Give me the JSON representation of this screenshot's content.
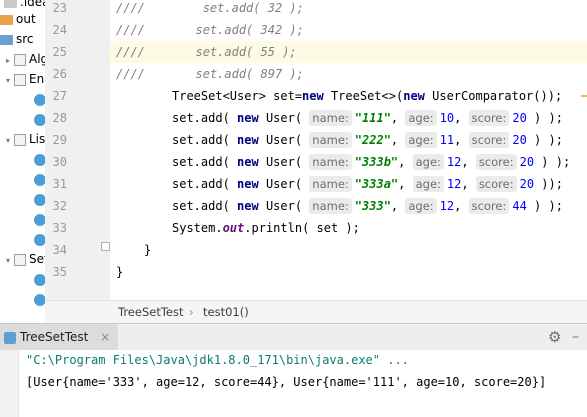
{
  "project_tree": {
    "items": [
      {
        "label": ".idea",
        "icon": "folder-plain"
      },
      {
        "label": "out",
        "icon": "folder-orange"
      },
      {
        "label": "src",
        "icon": "folder-blue"
      },
      {
        "label": "Alg",
        "icon": "package-icon"
      },
      {
        "label": "En",
        "icon": "package-icon"
      },
      {
        "label": "Lis",
        "icon": "package-icon"
      },
      {
        "label": "Set",
        "icon": "package-icon"
      }
    ]
  },
  "editor": {
    "lines": [
      {
        "num": "23"
      },
      {
        "num": "24"
      },
      {
        "num": "25"
      },
      {
        "num": "26"
      },
      {
        "num": "27"
      },
      {
        "num": "28"
      },
      {
        "num": "29"
      },
      {
        "num": "30"
      },
      {
        "num": "31"
      },
      {
        "num": "32"
      },
      {
        "num": "33"
      },
      {
        "num": "34"
      },
      {
        "num": "35"
      }
    ],
    "comment_prefix": "////",
    "commented_adds": [
      {
        "indent": "        ",
        "call": "set.add( ",
        "value": "32",
        "close": " );"
      },
      {
        "indent": "       ",
        "call": "set.add( ",
        "value": "342",
        "close": " );"
      },
      {
        "indent": "       ",
        "call": "set.add( ",
        "value": "55",
        "close": " );"
      },
      {
        "indent": "       ",
        "call": "set.add( ",
        "value": "897",
        "close": " );"
      }
    ],
    "treeset_line": {
      "type_text": "TreeSet<User> set=",
      "kw_new": "new",
      "mid_text": " TreeSet<>(",
      "kw_new2": "new",
      "end_text": " UserComparator());"
    },
    "add_calls": [
      {
        "prefix": "set.add( ",
        "kw": "new",
        "ctor": " User( ",
        "name_hint": "name:",
        "name": "\"111\"",
        "age_hint": "age:",
        "age": "10",
        "score_hint": "score:",
        "score": "20",
        "close": " ) );"
      },
      {
        "prefix": "set.add( ",
        "kw": "new",
        "ctor": " User( ",
        "name_hint": "name:",
        "name": "\"222\"",
        "age_hint": "age:",
        "age": "11",
        "score_hint": "score:",
        "score": "20",
        "close": " ) );"
      },
      {
        "prefix": "set.add( ",
        "kw": "new",
        "ctor": " User( ",
        "name_hint": "name:",
        "name": "\"333b\"",
        "age_hint": "age:",
        "age": "12",
        "score_hint": "score:",
        "score": "20",
        "close": " ) );"
      },
      {
        "prefix": "set.add( ",
        "kw": "new",
        "ctor": " User( ",
        "name_hint": "name:",
        "name": "\"333a\"",
        "age_hint": "age:",
        "age": "12",
        "score_hint": "score:",
        "score": "20",
        "close": " ));"
      },
      {
        "prefix": "set.add( ",
        "kw": "new",
        "ctor": " User( ",
        "name_hint": "name:",
        "name": "\"333\"",
        "age_hint": "age:",
        "age": "12",
        "score_hint": "score:",
        "score": "44",
        "close": " ) );"
      }
    ],
    "println_line": {
      "pre": "System.",
      "field": "out",
      "post": ".println( set );"
    },
    "close_method": "}",
    "close_class": "}"
  },
  "breadcrumb": {
    "class_name": "TreeSetTest",
    "separator": "›",
    "method_name": "test01()"
  },
  "run_panel": {
    "tab_label": "TreeSetTest",
    "close_glyph": "×",
    "command_line": "\"C:\\Program Files\\Java\\jdk1.8.0_171\\bin\\java.exe\" ...",
    "output_line": "[User{name='333', age=12, score=44}, User{name='111', age=10, score=20}]"
  },
  "colors": {
    "keyword": "#000080",
    "string": "#008000",
    "number": "#0000ff",
    "comment": "#808080",
    "current_line": "#fefbe5",
    "console_command": "#0a7d6f"
  }
}
